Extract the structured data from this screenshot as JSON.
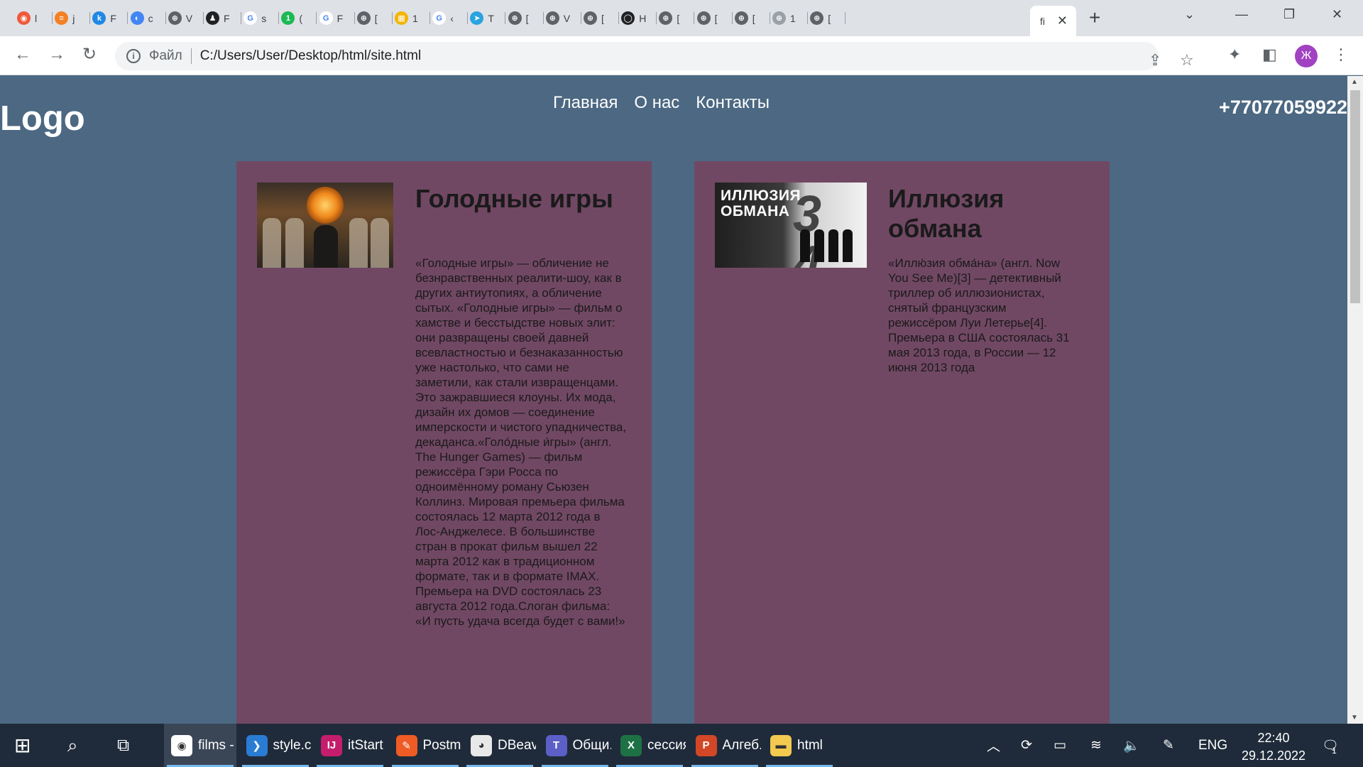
{
  "browser": {
    "tabs": [
      {
        "letter": "l",
        "color": "#ee5a3a",
        "symbol": "◉"
      },
      {
        "letter": "j",
        "color": "#f48024",
        "symbol": "≡"
      },
      {
        "letter": "F",
        "color": "#1e88e5",
        "symbol": "k"
      },
      {
        "letter": "c",
        "color": "#4285f4",
        "symbol": "◐"
      },
      {
        "letter": "V",
        "color": "#5f6368",
        "symbol": "⊕"
      },
      {
        "letter": "F",
        "color": "#202124",
        "symbol": "♟"
      },
      {
        "letter": "s",
        "color": "#ffffff",
        "symbol": "G"
      },
      {
        "letter": "(",
        "color": "#1db954",
        "symbol": "1"
      },
      {
        "letter": "F",
        "color": "#ffffff",
        "symbol": "G"
      },
      {
        "letter": "[",
        "color": "#5f6368",
        "symbol": "⊕"
      },
      {
        "letter": "1",
        "color": "#f4b400",
        "symbol": "▦"
      },
      {
        "letter": "‹",
        "color": "#ffffff",
        "symbol": "G"
      },
      {
        "letter": "T",
        "color": "#2aa3df",
        "symbol": "➤"
      },
      {
        "letter": "[",
        "color": "#5f6368",
        "symbol": "⊕"
      },
      {
        "letter": "V",
        "color": "#5f6368",
        "symbol": "⊕"
      },
      {
        "letter": "[",
        "color": "#5f6368",
        "symbol": "⊕"
      },
      {
        "letter": "H",
        "color": "#202124",
        "symbol": "◯"
      },
      {
        "letter": "[",
        "color": "#5f6368",
        "symbol": "⊕"
      },
      {
        "letter": "[",
        "color": "#5f6368",
        "symbol": "⊕"
      },
      {
        "letter": "[",
        "color": "#5f6368",
        "symbol": "⊕"
      },
      {
        "letter": "1",
        "color": "#9aa0a6",
        "symbol": "⊕"
      },
      {
        "letter": "[",
        "color": "#5f6368",
        "symbol": "⊕"
      }
    ],
    "active_tab": {
      "title": "fi"
    },
    "address": {
      "scheme_label": "Файл",
      "url": "C:/Users/User/Desktop/html/site.html"
    },
    "profile_initial": "Ж"
  },
  "site": {
    "logo": "Logo",
    "nav": [
      "Главная",
      "О нас",
      "Контакты"
    ],
    "phone": "+77077059922",
    "films": [
      {
        "title": "Голодные игры",
        "description": "«Голодные игры» — обличение не безнравственных реалити-шоу, как в других антиутопиях, а обличение сытых. «Голодные игры» — фильм о хамстве и бесстыдстве новых элит: они развращены своей давней всевластностью и безнаказанностью уже настолько, что сами не заметили, как стали извращенцами. Это зажравшиеся клоуны. Их мода, дизайн их домов — соединение имперскости и чистого упадничества, декаданса.«Голо́дные и́гры» (англ. The Hunger Games) — фильм режиссёра Гэри Росса по одноимённому роману Сьюзен Коллинз. Мировая премьера фильма состоялась 12 марта 2012 года в Лос-Анджелесе. В большинстве стран в прокат фильм вышел 22 марта 2012 как в традиционном формате, так и в формате IMAX. Премьера на DVD состоялась 23 августа 2012 года.Слоган фильма: «И пусть удача всегда будет с вами!»"
      },
      {
        "title": "Иллюзия обмана",
        "description": "«Иллю́зия обма́на» (англ. Now You See Me)[3] — детективный триллер об иллюзионистах, снятый французским режиссёром Луи Летерье[4]. Премьера в США состоялась 31 мая 2013 года, в России — 12 июня 2013 года",
        "poster_text": "ИЛЛЮЗИЯ ОБМАНА"
      }
    ]
  },
  "taskbar": {
    "apps": [
      {
        "label": "films - ...",
        "icon": "chrome-icon",
        "color": "#ffffff",
        "glyph": "◉"
      },
      {
        "label": "style.c...",
        "icon": "vscode-icon",
        "color": "#2a7bd4",
        "glyph": "❯"
      },
      {
        "label": "itStart ...",
        "icon": "intellij-icon",
        "color": "#c51d6d",
        "glyph": "IJ"
      },
      {
        "label": "Postm...",
        "icon": "postman-icon",
        "color": "#ef5b25",
        "glyph": "✎"
      },
      {
        "label": "DBeav...",
        "icon": "dbeaver-icon",
        "color": "#e8e8e8",
        "glyph": "◕"
      },
      {
        "label": "Общи...",
        "icon": "teams-icon",
        "color": "#5b5fc7",
        "glyph": "T"
      },
      {
        "label": "сессия...",
        "icon": "excel-icon",
        "color": "#1e7145",
        "glyph": "X"
      },
      {
        "label": "Алгеб...",
        "icon": "powerpoint-icon",
        "color": "#d24726",
        "glyph": "P"
      },
      {
        "label": "html",
        "icon": "folder-icon",
        "color": "#f3c94f",
        "glyph": "▬"
      }
    ],
    "language": "ENG",
    "time": "22:40",
    "date": "29.12.2022",
    "notification_count": "1"
  }
}
